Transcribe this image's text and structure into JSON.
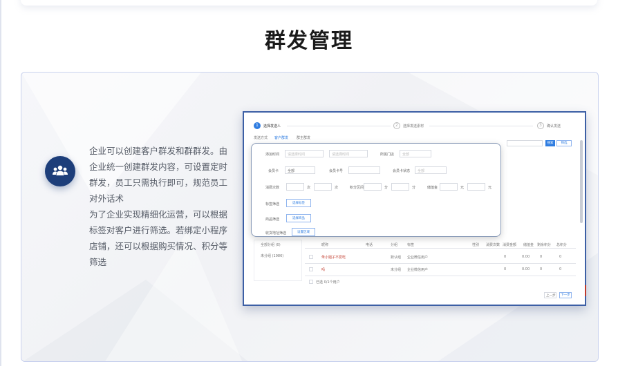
{
  "page": {
    "title": "群发管理",
    "description": [
      "企业可以创建客户群发和群群发。由企业统一创建群发内容，可设置定时群发，员工只需执行即可，规范员工对外话术",
      "为了企业实现精细化运营，可以根据标签对客户进行筛选。若绑定小程序店铺，还可以根据购买情况、积分等筛选"
    ],
    "badge_icon": "users-icon"
  },
  "screenshot": {
    "steps": [
      {
        "num": "1",
        "label": "选择发送人"
      },
      {
        "num": "2",
        "label": "选择发送素材"
      },
      {
        "num": "3",
        "label": "确认发送"
      }
    ],
    "send_mode_label": "发送方式",
    "send_mode_options": [
      "客户群发",
      "群主群发"
    ],
    "search_btn": "搜索",
    "filter_btn": "筛选",
    "filter": {
      "add_time_label": "添加时间",
      "start_placeholder": "请选择时间",
      "end_placeholder": "请选择时间",
      "store_label": "所属门店",
      "store_value": "全部",
      "member_card_label": "会员卡",
      "member_card_value": "全部",
      "member_no_label": "会员卡号",
      "member_status_label": "会员卡状态",
      "member_status_value": "全部",
      "consume_label": "消费次数",
      "consume_unit": "次",
      "points_label": "积分区间",
      "points_unit": "分",
      "amount_label": "储值金",
      "amount_unit": "元",
      "tag_label": "标签筛选",
      "tag_btn": "选择标签",
      "goods_label": "商品筛选",
      "goods_btn": "选择商品",
      "address_label": "收货地址筛选",
      "address_btn": "设置区域"
    },
    "left_list": [
      {
        "label": "全部分组 (0)"
      },
      {
        "label": "未分组 (1986)"
      }
    ],
    "table_headers": [
      "昵称",
      "电话",
      "分组",
      "标签",
      "性别",
      "消费次数",
      "消费金额",
      "储值金",
      "剩余积分",
      "总积分"
    ],
    "rows": [
      {
        "name": "朱小姐子不爱吃",
        "group": "默认组",
        "tag": "企业微信用户",
        "amount": "0",
        "money": "0.00",
        "points": "0",
        "total": "0"
      },
      {
        "name": "吗",
        "group": "未分组",
        "tag": "企业微信用户",
        "amount": "0",
        "money": "0.00",
        "points": "0",
        "total": "0"
      }
    ],
    "select_all": "已选 0/1个用户",
    "prev_btn": "上一步",
    "next_btn": "下一步",
    "colors": {
      "accent": "#2f7de1",
      "frame": "#3c5fa5",
      "badge": "#1d3e7a"
    }
  }
}
